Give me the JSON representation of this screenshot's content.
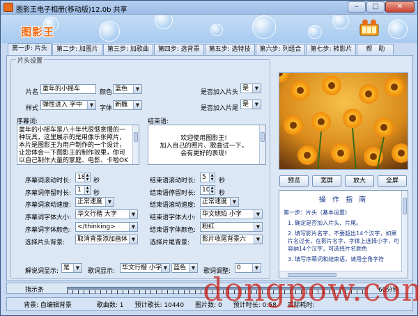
{
  "window": {
    "title": "图影王电子相册(移动版)12.0b 共享"
  },
  "banner": {
    "logo": "图影王"
  },
  "tabs": [
    {
      "label": "第一步: 片头"
    },
    {
      "label": "第二步: 加图片"
    },
    {
      "label": "第三步: 加歌曲"
    },
    {
      "label": "第四步: 选背景"
    },
    {
      "label": "第五步: 选特技"
    },
    {
      "label": "第六步: 列组合"
    },
    {
      "label": "第七步: 转影片"
    },
    {
      "label": "帮　助"
    }
  ],
  "form": {
    "group_title": "片头设置",
    "name_label": "片名",
    "name_value": "童年的小摇车",
    "color_label": "颜色",
    "color_value": "蓝色",
    "style_label": "样式",
    "style_value": "弹性进入 字中",
    "font_label": "字体",
    "font_value": "新魏",
    "add_head_label": "是否加入片头",
    "add_head_value": "是",
    "add_tail_label": "是否加入片尾",
    "add_tail_value": "是",
    "preface_label": "序幕词:",
    "preface_text": "童年的小摇车是八十年代很惬意慢的一种玩具，这里展示的是用像乐张照片，本片是图影王为用户制作的一个设计，让您体会一下图影王的制作效果，你可以自己制作大量的家庭、电影、卡啦OK片、MTV片等，给的影片",
    "ending_label": "结束语:",
    "ending_text": "欢迎使用图影王!\n加入自己的照片、歌曲试一下，\n会有更好的表现!",
    "preface_scroll_time_label": "序幕词滚动时长:",
    "preface_scroll_time": "18",
    "preface_stay_time_label": "序幕词停留时长:",
    "preface_stay_time": "1",
    "preface_speed_label": "序幕词滚动速度:",
    "preface_speed": "正常速度",
    "preface_font_size_label": "序幕词字体大小:",
    "preface_font_size": "华文行楷 大字",
    "preface_font_color_label": "序幕词字体颜色:",
    "preface_font_color": "</thinking>",
    "head_bg_label": "选择片头背景:",
    "head_bg": "取消背景添加画体",
    "ending_scroll_time_label": "结束语滚动时长:",
    "ending_scroll_time": "5",
    "ending_stay_time_label": "结束语停留时长:",
    "ending_stay_time": "10",
    "ending_speed_label": "结束语滚动速度:",
    "ending_speed": "正常速度",
    "ending_font_size_label": "结束语字体大小:",
    "ending_font_size": "华文琥珀 小字",
    "ending_font_color_label": "结束语字体颜色:",
    "ending_font_color": "粉红",
    "tail_bg_label": "选择片尾背景:",
    "tail_bg": "影片收尾背景六",
    "seconds_unit": "秒",
    "lyrics_display_label": "解说词显示:",
    "lyrics_display_value": "是",
    "lyrics_show_label": "歌词显示:",
    "lyrics_font": "华文行楷 小字",
    "lyrics_color": "蓝色",
    "lyrics_adjust_label": "歌词调整:",
    "lyrics_adjust_value": "0"
  },
  "preview": {
    "buttons": [
      {
        "label": "预览"
      },
      {
        "label": "宽屏"
      },
      {
        "label": "放大"
      },
      {
        "label": "全屏"
      }
    ]
  },
  "guide": {
    "title": "操 作 指 南",
    "step": "第一步：片头（基本设置）",
    "items": [
      "1. 确定是否加入片头、片尾。",
      "2. 填写影片名字，不要超出14个汉字，如果片名过长，在影片名字、字体上选择小字，可容纳14个汉字，可选择片名颜色",
      "3. 填写序幕词和结束语，请用全角字符"
    ]
  },
  "indicator": {
    "label": "指示条",
    "end_label": "60分钟",
    "progress": 0.0
  },
  "status": {
    "background": "背景: 自编辑背景",
    "songs": "歌曲数:  1",
    "estimated": "预计歌长: 10440",
    "pics": "图片数:  0",
    "total": "预计时长:  0:58",
    "actual": "实际耗时:"
  },
  "watermark": "dongpow.com"
}
